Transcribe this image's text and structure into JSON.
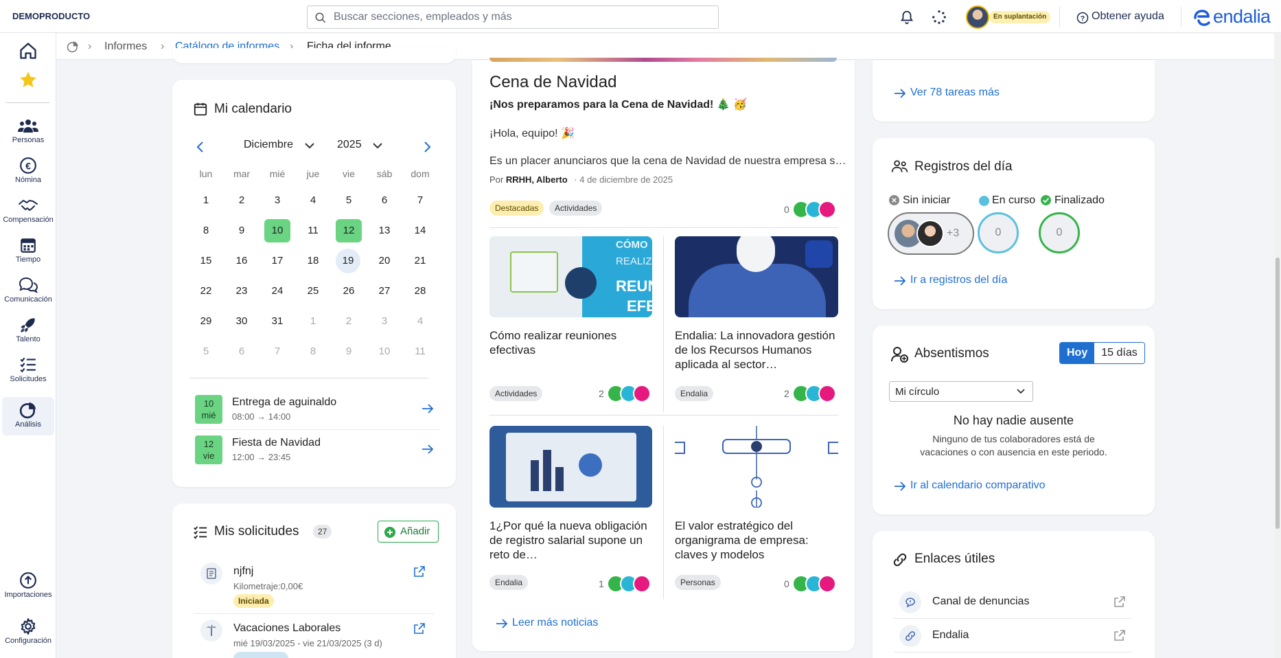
{
  "app": {
    "brand": "DEMOPRODUCTO",
    "logo": "endalia"
  },
  "search": {
    "placeholder": "Buscar secciones, empleados y más"
  },
  "header": {
    "impersonation_label": "En suplantación",
    "help_label": "Obtener ayuda"
  },
  "sidebar": {
    "items": [
      {
        "label": "",
        "icon": "home-icon"
      },
      {
        "label": "",
        "icon": "star-icon"
      },
      {
        "label": "Personas",
        "icon": "people-icon"
      },
      {
        "label": "Nómina",
        "icon": "euro-icon"
      },
      {
        "label": "Compensación",
        "icon": "handshake-icon"
      },
      {
        "label": "Tiempo",
        "icon": "calendar-icon"
      },
      {
        "label": "Comunicación",
        "icon": "chat-icon"
      },
      {
        "label": "Talento",
        "icon": "rocket-icon"
      },
      {
        "label": "Solicitudes",
        "icon": "checklist-icon"
      },
      {
        "label": "Análisis",
        "icon": "pie-chart-icon"
      },
      {
        "label": "Importaciones",
        "icon": "upload-icon"
      },
      {
        "label": "Configuración",
        "icon": "gear-icon"
      }
    ]
  },
  "breadcrumb": {
    "items": [
      "Informes",
      "Catálogo de informes",
      "Ficha del informe"
    ]
  },
  "calendar": {
    "title": "Mi calendario",
    "month": "Diciembre",
    "year": "2025",
    "weekdays": [
      "lun",
      "mar",
      "mié",
      "jue",
      "vie",
      "sáb",
      "dom"
    ],
    "weeks": [
      [
        "1",
        "2",
        "3",
        "4",
        "5",
        "6",
        "7"
      ],
      [
        "8",
        "9",
        "10",
        "11",
        "12",
        "13",
        "14"
      ],
      [
        "15",
        "16",
        "17",
        "18",
        "19",
        "20",
        "21"
      ],
      [
        "22",
        "23",
        "24",
        "25",
        "26",
        "27",
        "28"
      ],
      [
        "29",
        "30",
        "31",
        "1",
        "2",
        "3",
        "4"
      ],
      [
        "5",
        "6",
        "7",
        "8",
        "9",
        "10",
        "11"
      ]
    ],
    "events": [
      {
        "day": "10",
        "weekday": "mié",
        "title": "Entrega de aguinaldo",
        "time": "08:00 → 14:00"
      },
      {
        "day": "12",
        "weekday": "vie",
        "title": "Fiesta de Navidad",
        "time": "12:00 → 23:45"
      }
    ]
  },
  "requests": {
    "title": "Mis solicitudes",
    "count": "27",
    "add_label": "Añadir",
    "items": [
      {
        "title": "njfnj",
        "detail": "Kilometraje:0,00€",
        "status": "Iniciada"
      },
      {
        "title": "Vacaciones Laborales",
        "detail": "mié 19/03/2025 - vie 21/03/2025 (3 d)",
        "status": ""
      }
    ]
  },
  "news": {
    "featured": {
      "title": "Cena de Navidad",
      "subtitle": "¡Nos preparamos para la Cena de Navidad! 🎄 🥳",
      "greeting": "¡Hola, equipo! 🎉",
      "excerpt": "Es un placer anunciaros que la cena de Navidad de nuestra empresa s…",
      "by_prefix": "Por",
      "author": "RRHH, Alberto",
      "date": "· 4 de diciembre de 2025",
      "tags": [
        "Destacadas",
        "Actividades"
      ],
      "reactions": "0"
    },
    "cards": [
      {
        "title": "Cómo realizar reuniones efectivas",
        "tag": "Actividades",
        "reactions": "2",
        "thumb_text": [
          "CÓMO",
          "REALIZ",
          "REUN",
          "EFE"
        ]
      },
      {
        "title": "Endalia: La innovadora gestión de los Recursos Humanos aplicada al sector…",
        "tag": "Endalia",
        "reactions": "2"
      },
      {
        "title": "1¿Por qué la nueva obligación de registro salarial supone un reto de…",
        "tag": "Endalia",
        "reactions": "1"
      },
      {
        "title": "El valor estratégico del organigrama de empresa: claves y modelos",
        "tag": "Personas",
        "reactions": "0"
      }
    ],
    "more_label": "Leer más noticias"
  },
  "tasks": {
    "more_label": "Ver 78 tareas más"
  },
  "registros": {
    "title": "Registros del día",
    "legend": [
      "Sin iniciar",
      "En curso",
      "Finalizado"
    ],
    "not_started_extra": "+3",
    "in_progress": "0",
    "finished": "0",
    "link": "Ir a registros del día"
  },
  "absences": {
    "title": "Absentismos",
    "seg": [
      "Hoy",
      "15 días"
    ],
    "filter": "Mi círculo",
    "empty_title": "No hay nadie ausente",
    "empty_text_1": "Ninguno de tus colaboradores está de",
    "empty_text_2": "vacaciones o con ausencia en este periodo.",
    "link": "Ir al calendario comparativo"
  },
  "links": {
    "title": "Enlaces útiles",
    "items": [
      "Canal de denuncias",
      "Endalia"
    ]
  },
  "colors": {
    "accent": "#1f6fd1",
    "green": "#6ad483",
    "like": "#35b44a",
    "idea": "#29b5d6",
    "love": "#e5197e"
  }
}
